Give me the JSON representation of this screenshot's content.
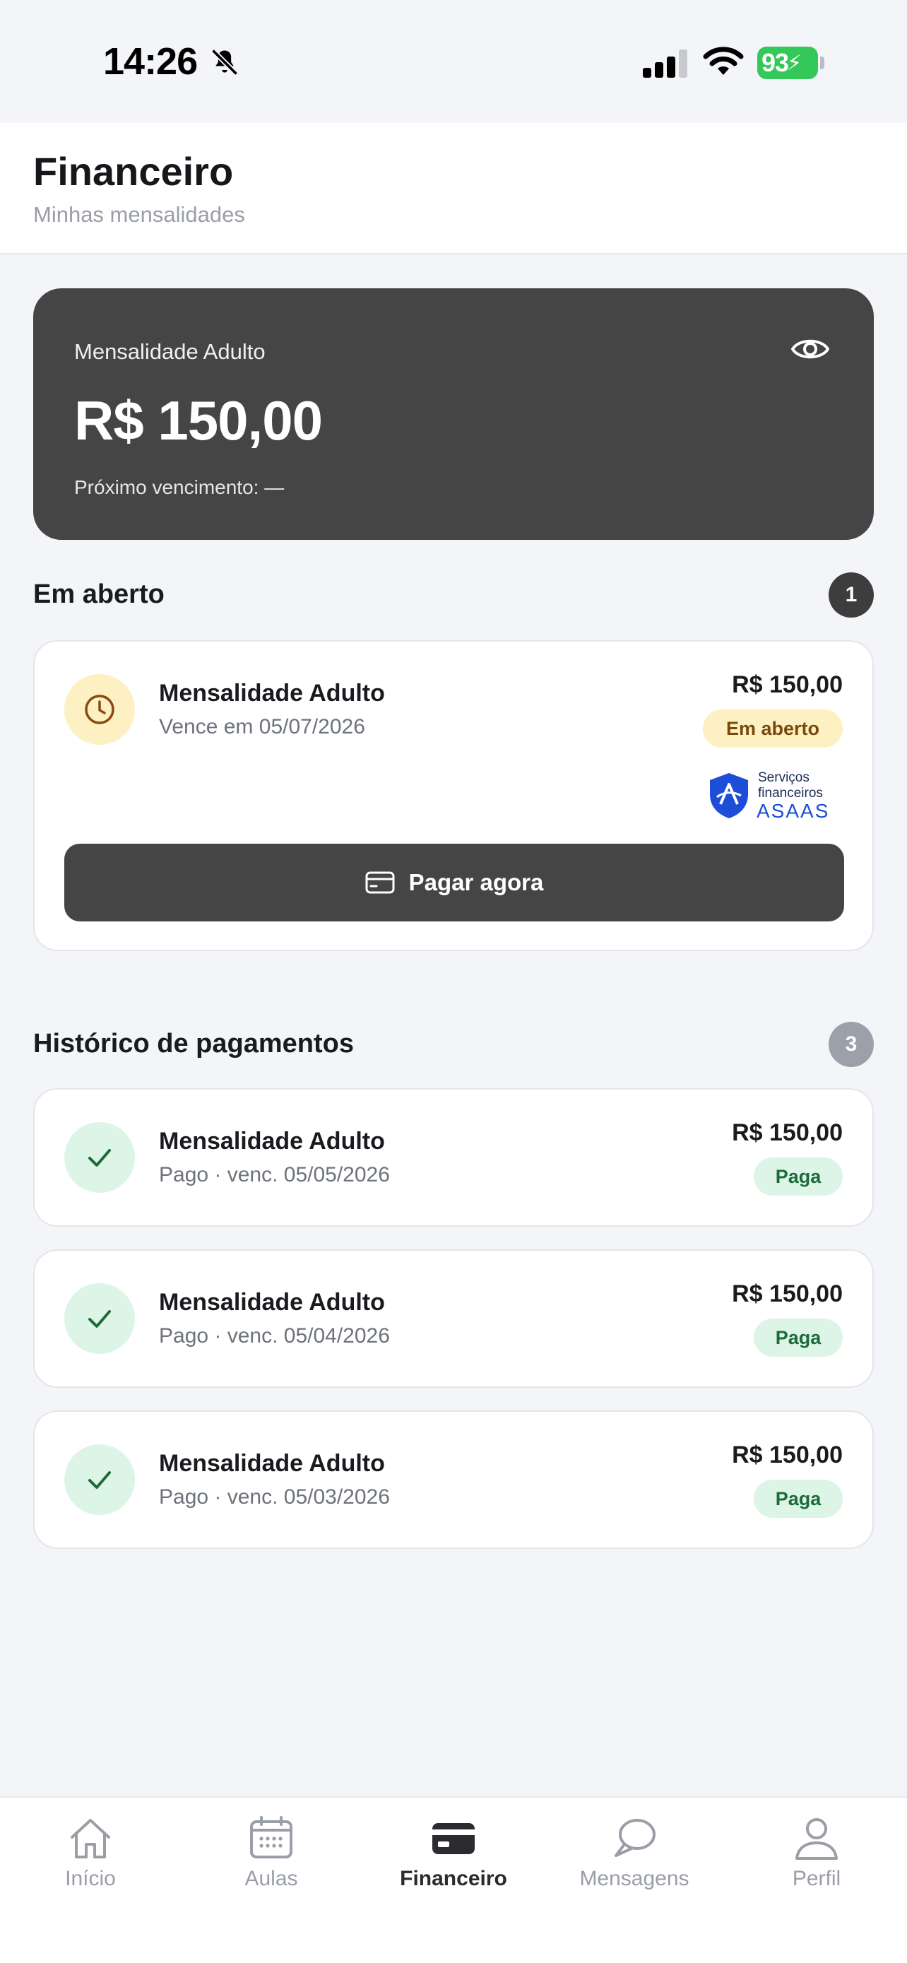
{
  "status_bar": {
    "time": "14:26",
    "battery": "93"
  },
  "header": {
    "title": "Financeiro",
    "subtitle": "Minhas mensalidades"
  },
  "summary": {
    "label": "Mensalidade Adulto",
    "amount": "R$ 150,00",
    "next_due": "Próximo vencimento: —"
  },
  "open_section": {
    "title": "Em aberto",
    "count": "1",
    "items": [
      {
        "title": "Mensalidade Adulto",
        "subtitle": "Vence em 05/07/2026",
        "amount": "R$ 150,00",
        "status": "Em aberto"
      }
    ],
    "provider": {
      "line1": "Serviços",
      "line2": "financeiros",
      "brand": "ASAAS"
    },
    "pay_button": "Pagar agora"
  },
  "history_section": {
    "title": "Histórico de pagamentos",
    "count": "3",
    "items": [
      {
        "title": "Mensalidade Adulto",
        "subtitle": "Pago · venc. 05/05/2026",
        "amount": "R$ 150,00",
        "status": "Paga"
      },
      {
        "title": "Mensalidade Adulto",
        "subtitle": "Pago · venc. 05/04/2026",
        "amount": "R$ 150,00",
        "status": "Paga"
      },
      {
        "title": "Mensalidade Adulto",
        "subtitle": "Pago · venc. 05/03/2026",
        "amount": "R$ 150,00",
        "status": "Paga"
      }
    ]
  },
  "tabbar": {
    "items": [
      {
        "label": "Início",
        "icon": "home-icon"
      },
      {
        "label": "Aulas",
        "icon": "calendar-icon"
      },
      {
        "label": "Financeiro",
        "icon": "wallet-icon",
        "active": true
      },
      {
        "label": "Mensagens",
        "icon": "chat-icon"
      },
      {
        "label": "Perfil",
        "icon": "user-icon"
      }
    ]
  },
  "colors": {
    "dark_card": "#454545",
    "open_pill_bg": "#fdf0c2",
    "open_pill_text": "#7a4a0c",
    "paid_pill_bg": "#dcf5e6",
    "paid_pill_text": "#1d6b3a",
    "battery_green": "#34c759",
    "asaas_blue": "#1d4ed8"
  }
}
